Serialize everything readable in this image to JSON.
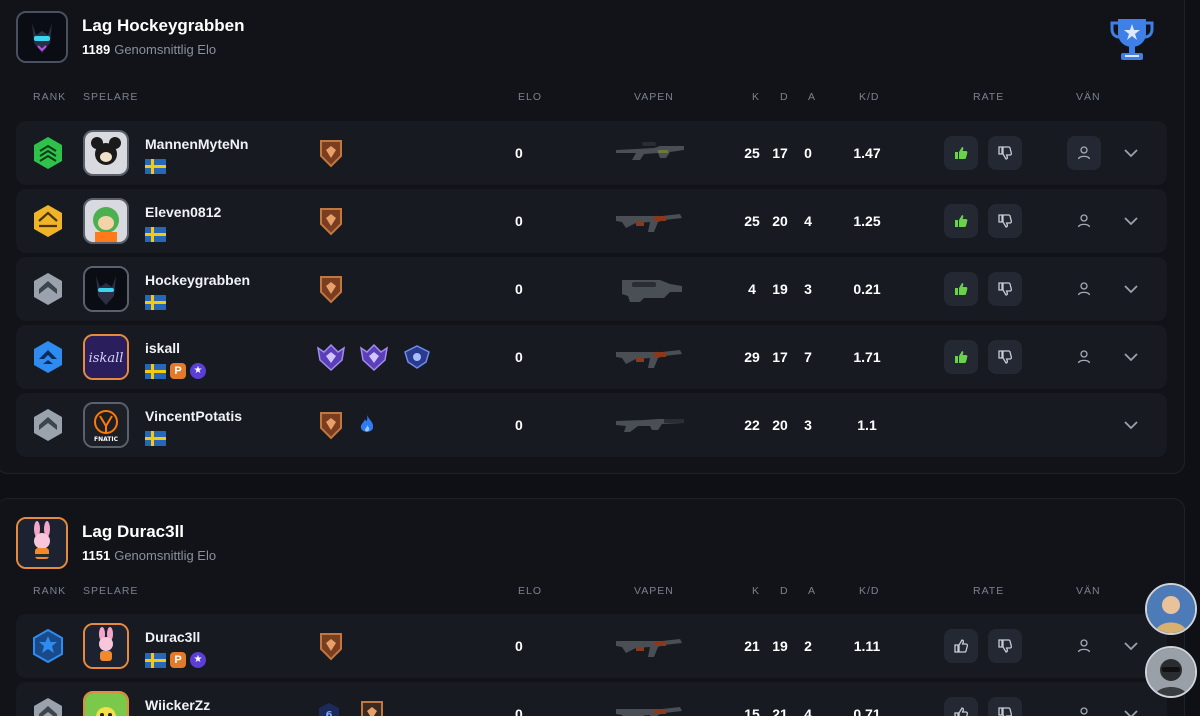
{
  "teams": [
    {
      "name": "Lag Hockeygrabben",
      "avg_elo": "1189",
      "avg_elo_label": "Genomsnittlig Elo",
      "columns": {
        "rank": "RANK",
        "player": "SPELARE",
        "elo": "ELO",
        "weapon": "VAPEN",
        "k": "K",
        "d": "D",
        "a": "A",
        "kd": "K/D",
        "rate": "RATE",
        "friend": "VÄN"
      },
      "players": [
        {
          "name": "MannenMyteNn",
          "elo": "0",
          "k": "25",
          "d": "17",
          "a": "0",
          "kd": "1.47",
          "rank_color": "#2fc24a",
          "weapon": "awp-icon",
          "rated_up": true
        },
        {
          "name": "Eleven0812",
          "elo": "0",
          "k": "25",
          "d": "20",
          "a": "4",
          "kd": "1.25",
          "rank_color": "#f0b429",
          "weapon": "ak47-icon",
          "rated_up": true
        },
        {
          "name": "Hockeygrabben",
          "elo": "0",
          "k": "4",
          "d": "19",
          "a": "3",
          "kd": "0.21",
          "rank_color": "#9aa3ad",
          "weapon": "p90-icon",
          "rated_up": true
        },
        {
          "name": "iskall",
          "elo": "0",
          "k": "29",
          "d": "17",
          "a": "7",
          "kd": "1.71",
          "rank_color": "#2e8cf0",
          "weapon": "ak47-icon",
          "rated_up": true
        },
        {
          "name": "VincentPotatis",
          "elo": "0",
          "k": "22",
          "d": "20",
          "a": "3",
          "kd": "1.1",
          "rank_color": "#9aa3ad",
          "weapon": "m4a1s-icon",
          "rated_up": false
        }
      ]
    },
    {
      "name": "Lag Durac3ll",
      "avg_elo": "1151",
      "avg_elo_label": "Genomsnittlig Elo",
      "columns": {
        "rank": "RANK",
        "player": "SPELARE",
        "elo": "ELO",
        "weapon": "VAPEN",
        "k": "K",
        "d": "D",
        "a": "A",
        "kd": "K/D",
        "rate": "RATE",
        "friend": "VÄN"
      },
      "players": [
        {
          "name": "Durac3ll",
          "elo": "0",
          "k": "21",
          "d": "19",
          "a": "2",
          "kd": "1.11",
          "rank_color": "#2e8cf0",
          "weapon": "ak47-icon",
          "rated_up": false
        },
        {
          "name": "WiickerZz",
          "elo": "0",
          "k": "15",
          "d": "21",
          "a": "4",
          "kd": "0.71",
          "rank_color": "#9aa3ad",
          "weapon": "ak47-icon",
          "rated_up": false
        }
      ]
    }
  ],
  "badges": {
    "p": "P",
    "star": "★",
    "level": "6"
  },
  "colors": {
    "rate_up_active": "#6ad14a",
    "accent_orange": "#e58a3e",
    "trophy": "#3f7fe8"
  }
}
